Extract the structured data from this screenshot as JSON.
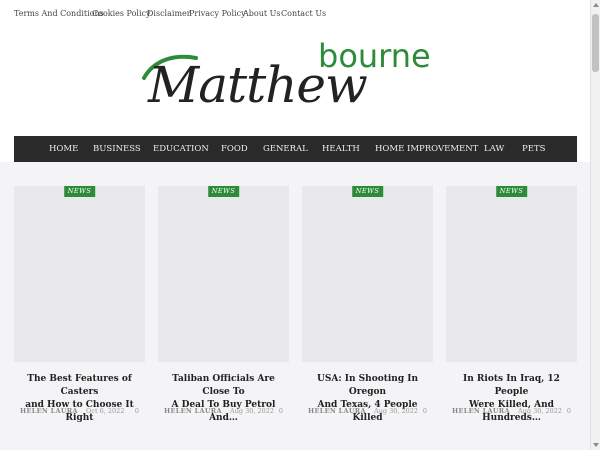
{
  "topbar": {
    "links": [
      "Terms And Conditions",
      "Cookies Policy",
      "Disclaimer",
      "Privacy Policy",
      "About Us",
      "Contact Us"
    ]
  },
  "logo": {
    "part1": "Matthew",
    "part2": "bourne",
    "colors": {
      "primary": "#222222",
      "accent": "#2e8b3a"
    }
  },
  "nav": {
    "items": [
      "HOME",
      "BUSINESS",
      "EDUCATION",
      "FOOD",
      "GENERAL",
      "HEALTH",
      "HOME IMPROVEMENT",
      "LAW",
      "PETS"
    ]
  },
  "posts": [
    {
      "badge": "NEWS",
      "title_line1": "The Best Features of Casters",
      "title_line2": "and How to Choose It Right",
      "author": "HELEN LAURA",
      "date": "Oct 6, 2022",
      "comments": "0"
    },
    {
      "badge": "NEWS",
      "title_line1": "Taliban Officials Are Close To",
      "title_line2": "A Deal To Buy Petrol And…",
      "author": "HELEN LAURA",
      "date": "Aug 30, 2022",
      "comments": "0"
    },
    {
      "badge": "NEWS",
      "title_line1": "USA: In Shooting In Oregon",
      "title_line2": "And Texas, 4 People Killed",
      "author": "HELEN LAURA",
      "date": "Aug 30, 2022",
      "comments": "0"
    },
    {
      "badge": "NEWS",
      "title_line1": "In Riots In Iraq, 12 People",
      "title_line2": "Were Killed, And Hundreds…",
      "author": "HELEN LAURA",
      "date": "Aug 30, 2022",
      "comments": "0"
    }
  ]
}
